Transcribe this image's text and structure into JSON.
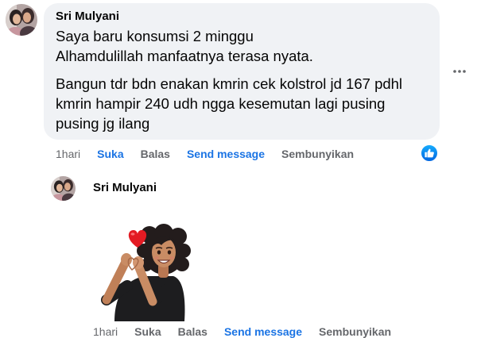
{
  "comment": {
    "author": "Sri Mulyani",
    "avatar_icon": "profile-photo-avatar",
    "paragraphs": [
      [
        "Saya baru konsumsi 2 minggu",
        "Alhamdulillah manfaatnya terasa nyata."
      ],
      [
        "Bangun tdr bdn enakan kmrin cek kolstrol jd 167 pdhl",
        "kmrin hampir 240 udh ngga kesemutan lagi pusing",
        "pusing jg ilang"
      ]
    ],
    "time": "1hari",
    "actions": {
      "like": "Suka",
      "reply": "Balas",
      "message": "Send message",
      "hide": "Sembunyikan"
    },
    "liked": true,
    "reaction_icon": "like-reaction-icon",
    "more_icon": "more-options-icon"
  },
  "reply": {
    "author": "Sri Mulyani",
    "avatar_icon": "profile-photo-avatar",
    "sticker_icon": "heart-hands-avatar-sticker",
    "time": "1hari",
    "actions": {
      "like": "Suka",
      "reply": "Balas",
      "message": "Send message",
      "hide": "Sembunyikan"
    },
    "liked": false
  },
  "colors": {
    "bubble": "#f0f2f5",
    "text": "#050505",
    "muted": "#65676b",
    "accent": "#1b74e4",
    "heart": "#e31b23"
  }
}
